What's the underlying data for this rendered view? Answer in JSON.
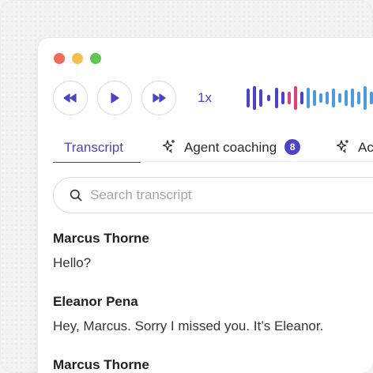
{
  "player": {
    "rewind_icon": "rewind-icon",
    "play_icon": "play-icon",
    "forward_icon": "fast-forward-icon",
    "speed": "1x",
    "waveform_colors": [
      "#4b44c9",
      "#d64575",
      "#4f9be0"
    ]
  },
  "tabs": [
    {
      "label": "Transcript",
      "active": true
    },
    {
      "label": "Agent coaching",
      "badge": "8",
      "icon": "sparkle-icon"
    },
    {
      "label": "Ac",
      "icon": "sparkle-icon"
    }
  ],
  "search": {
    "placeholder": "Search transcript",
    "value": ""
  },
  "transcript": [
    {
      "speaker": "Marcus Thorne",
      "text": "Hello?"
    },
    {
      "speaker": "Eleanor Pena",
      "text": "Hey, Marcus. Sorry I missed you. It’s Eleanor."
    },
    {
      "speaker": "Marcus Thorne",
      "text": ""
    }
  ],
  "colors": {
    "accent": "#4b44c9",
    "close": "#ee6a5f",
    "minimize": "#f5bf4f",
    "maximize": "#61c554"
  }
}
